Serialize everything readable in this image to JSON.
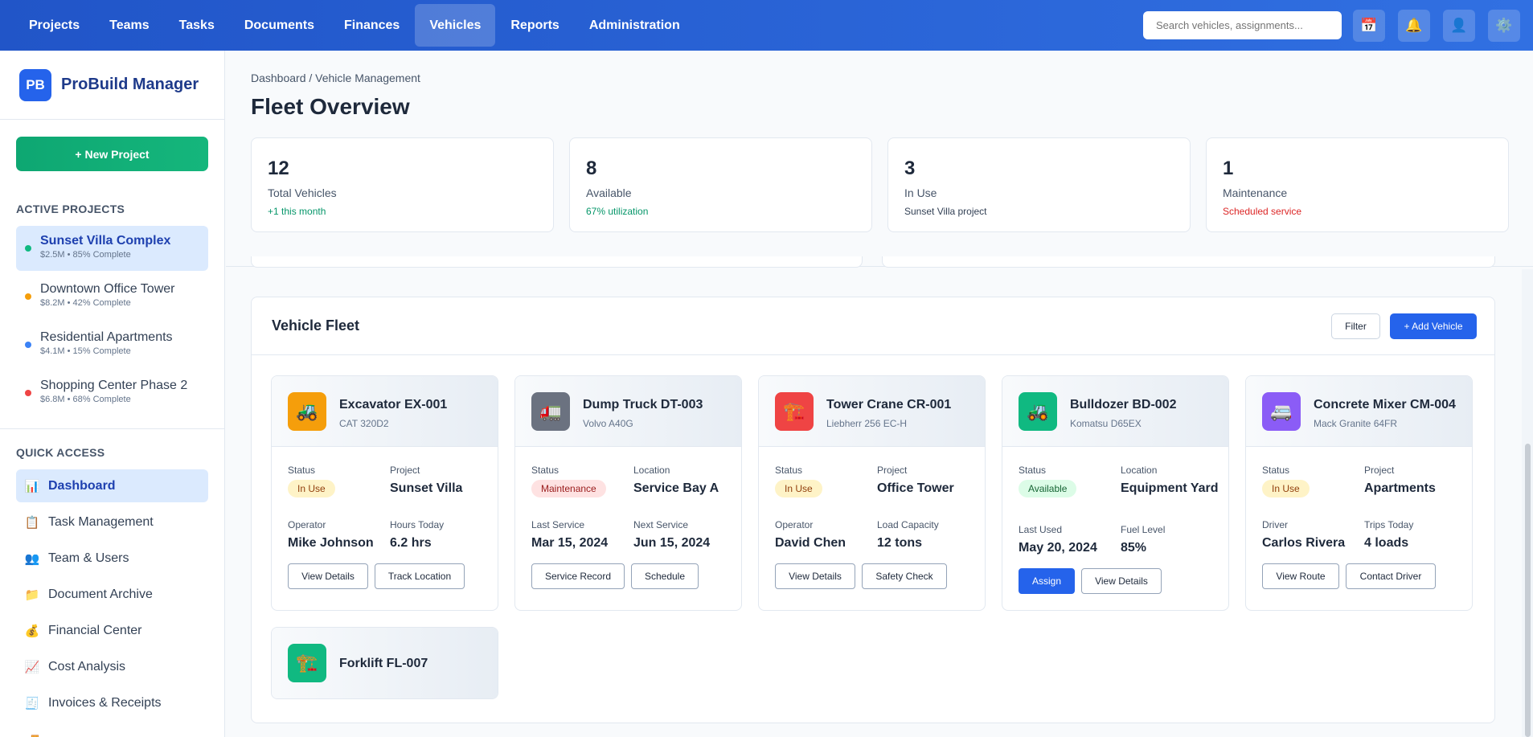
{
  "topnav": {
    "items": [
      "Projects",
      "Teams",
      "Tasks",
      "Documents",
      "Finances",
      "Vehicles",
      "Reports",
      "Administration"
    ],
    "active": "Vehicles",
    "search_placeholder": "Search vehicles, assignments...",
    "icons": [
      "calendar-icon",
      "bell-icon",
      "user-icon",
      "gear-icon"
    ]
  },
  "sidebar": {
    "logo": "PB",
    "brand": "ProBuild Manager",
    "new_project": "+ New Project",
    "active_projects_heading": "ACTIVE PROJECTS",
    "projects": [
      {
        "name": "Sunset Villa Complex",
        "meta": "$2.5M • 85% Complete",
        "color": "#10b981"
      },
      {
        "name": "Downtown Office Tower",
        "meta": "$8.2M • 42% Complete",
        "color": "#f59e0b"
      },
      {
        "name": "Residential Apartments",
        "meta": "$4.1M • 15% Complete",
        "color": "#3b82f6"
      },
      {
        "name": "Shopping Center Phase 2",
        "meta": "$6.8M • 68% Complete",
        "color": "#ef4444"
      }
    ],
    "quick_access_heading": "QUICK ACCESS",
    "quick": [
      {
        "label": "Dashboard",
        "icon": "📊"
      },
      {
        "label": "Task Management",
        "icon": "📋"
      },
      {
        "label": "Team & Users",
        "icon": "👥"
      },
      {
        "label": "Document Archive",
        "icon": "📁"
      },
      {
        "label": "Financial Center",
        "icon": "💰"
      },
      {
        "label": "Cost Analysis",
        "icon": "📈"
      },
      {
        "label": "Invoices & Receipts",
        "icon": "🧾"
      },
      {
        "label": "",
        "icon": "🚚"
      }
    ]
  },
  "main": {
    "breadcrumb": "Dashboard / Vehicle Management",
    "title": "Fleet Overview",
    "stats": [
      {
        "num": "12",
        "label": "Total Vehicles",
        "sub": "+1 this month",
        "sub_color": "#059669"
      },
      {
        "num": "8",
        "label": "Available",
        "sub": "67% utilization",
        "sub_color": "#059669"
      },
      {
        "num": "3",
        "label": "In Use",
        "sub": "Sunset Villa project",
        "sub_color": "#334155"
      },
      {
        "num": "1",
        "label": "Maintenance",
        "sub": "Scheduled service",
        "sub_color": "#dc2626"
      }
    ]
  },
  "fleet": {
    "title": "Vehicle Fleet",
    "filter": "Filter",
    "add": "+ Add Vehicle",
    "vehicles": [
      {
        "name": "Excavator EX-001",
        "model": "CAT 320D2",
        "icon": "🚜",
        "icon_bg": "#f59e0b",
        "f1_label": "Status",
        "status": "In Use",
        "status_class": "inuse",
        "f2_label": "Project",
        "f2_val": "Sunset Villa",
        "f3_label": "Operator",
        "f3_val": "Mike Johnson",
        "f4_label": "Hours Today",
        "f4_val": "6.2 hrs",
        "b1": "View Details",
        "b2": "Track Location"
      },
      {
        "name": "Dump Truck DT-003",
        "model": "Volvo A40G",
        "icon": "🚛",
        "icon_bg": "#6b7280",
        "f1_label": "Status",
        "status": "Maintenance",
        "status_class": "maint",
        "f2_label": "Location",
        "f2_val": "Service Bay A",
        "f3_label": "Last Service",
        "f3_val": "Mar 15, 2024",
        "f4_label": "Next Service",
        "f4_val": "Jun 15, 2024",
        "b1": "Service Record",
        "b2": "Schedule"
      },
      {
        "name": "Tower Crane CR-001",
        "model": "Liebherr 256 EC-H",
        "icon": "🏗️",
        "icon_bg": "#ef4444",
        "f1_label": "Status",
        "status": "In Use",
        "status_class": "inuse",
        "f2_label": "Project",
        "f2_val": "Office Tower",
        "f3_label": "Operator",
        "f3_val": "David Chen",
        "f4_label": "Load Capacity",
        "f4_val": "12 tons",
        "b1": "View Details",
        "b2": "Safety Check"
      },
      {
        "name": "Bulldozer BD-002",
        "model": "Komatsu D65EX",
        "icon": "🚜",
        "icon_bg": "#10b981",
        "f1_label": "Status",
        "status": "Available",
        "status_class": "avail",
        "f2_label": "Location",
        "f2_val": "Equipment Yard",
        "f3_label": "Last Used",
        "f3_val": "May 20, 2024",
        "f4_label": "Fuel Level",
        "f4_val": "85%",
        "b1": "Assign",
        "b2": "View Details"
      },
      {
        "name": "Concrete Mixer CM-004",
        "model": "Mack Granite 64FR",
        "icon": "🚐",
        "icon_bg": "#8b5cf6",
        "f1_label": "Status",
        "status": "In Use",
        "status_class": "inuse",
        "f2_label": "Project",
        "f2_val": "Apartments",
        "f3_label": "Driver",
        "f3_val": "Carlos Rivera",
        "f4_label": "Trips Today",
        "f4_val": "4 loads",
        "b1": "View Route",
        "b2": "Contact Driver"
      },
      {
        "name": "Forklift FL-007",
        "icon": "🏗️",
        "icon_bg": "#10b981"
      }
    ]
  }
}
